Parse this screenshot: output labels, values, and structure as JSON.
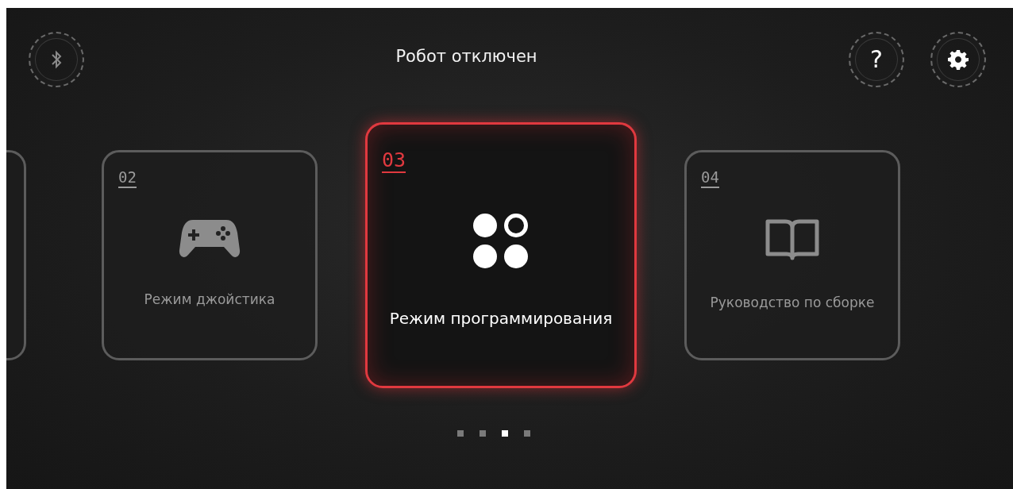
{
  "header": {
    "bluetooth": {
      "connected": false
    },
    "title": "Робот отключен",
    "help_button": {
      "label": "?"
    }
  },
  "cards": [
    {
      "kind": "partial",
      "selected": false
    },
    {
      "kind": "joystick",
      "number": "02",
      "label": "Режим джойстика",
      "selected": false
    },
    {
      "kind": "blocks",
      "number": "03",
      "label": "Режим программирования",
      "selected": true
    },
    {
      "kind": "book",
      "number": "04",
      "label": "Руководство по сборке",
      "selected": false
    }
  ],
  "pagination": [
    {
      "selected": false
    },
    {
      "selected": false
    },
    {
      "selected": true
    },
    {
      "selected": false
    }
  ]
}
